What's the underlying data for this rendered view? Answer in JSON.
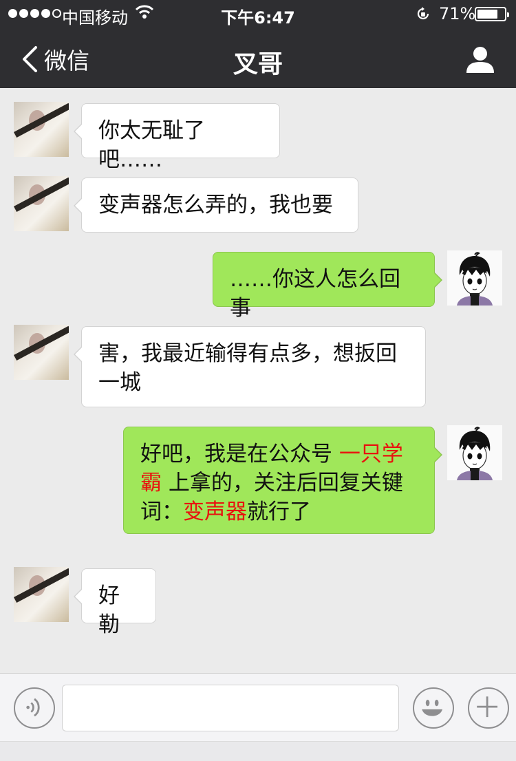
{
  "status_bar": {
    "carrier": "中国移动",
    "time": "下午6:47",
    "battery": "71%"
  },
  "nav": {
    "back_label": "微信",
    "title": "叉哥"
  },
  "messages": [
    {
      "from": "other",
      "text": "你太无耻了吧……"
    },
    {
      "from": "other",
      "text": "变声器怎么弄的，我也要"
    },
    {
      "from": "me",
      "text": "……你这人怎么回事"
    },
    {
      "from": "other",
      "text": "害，我最近输得有点多，想扳回一城"
    },
    {
      "from": "me",
      "parts": [
        "好吧，我是在公众号 ",
        "一只学霸",
        " 上拿的，关注后回复关键词：",
        "变声器",
        "就行了"
      ]
    },
    {
      "from": "other",
      "text": "好勒"
    }
  ],
  "colors": {
    "nav_bg": "#2e2e31",
    "chat_bg": "#ebebeb",
    "my_bubble": "#a0e75a",
    "highlight": "#e8120f"
  },
  "icons": [
    "back-chevron-icon",
    "profile-icon",
    "wifi-icon",
    "rotation-lock-icon",
    "voice-icon",
    "emoji-icon",
    "plus-icon"
  ]
}
